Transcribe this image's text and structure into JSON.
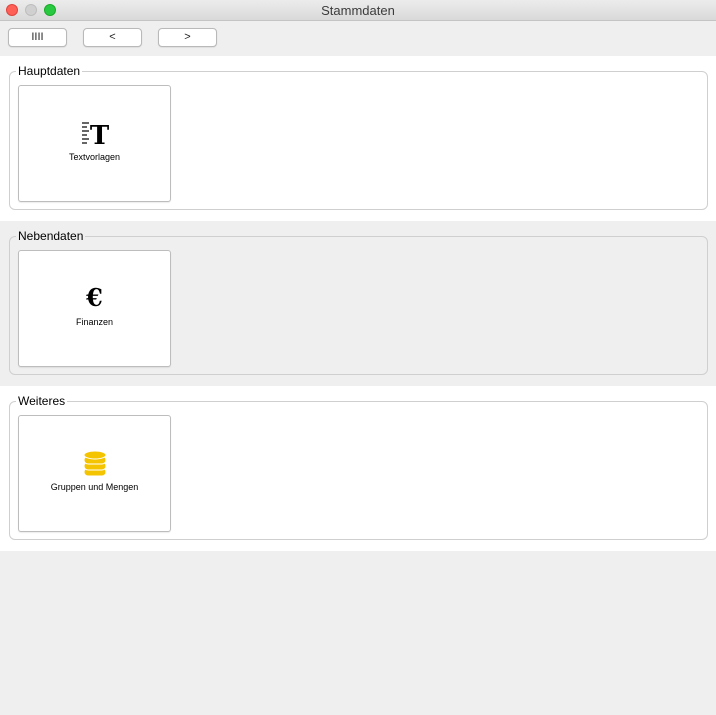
{
  "window": {
    "title": "Stammdaten"
  },
  "toolbar": {
    "buttons": [
      {
        "label": "IIII",
        "icon": "barcode-icon"
      },
      {
        "label": "<",
        "icon": "back-icon"
      },
      {
        "label": ">",
        "icon": "forward-icon"
      }
    ]
  },
  "groups": [
    {
      "title": "Hauptdaten",
      "tiles": [
        {
          "label": "Textvorlagen",
          "icon": "text-template-icon"
        }
      ]
    },
    {
      "title": "Nebendaten",
      "tiles": [
        {
          "label": "Finanzen",
          "icon": "euro-icon",
          "glyph": "€"
        }
      ]
    },
    {
      "title": "Weiteres",
      "tiles": [
        {
          "label": "Gruppen und Mengen",
          "icon": "coin-stack-icon",
          "color": "#f5c400"
        }
      ]
    }
  ]
}
